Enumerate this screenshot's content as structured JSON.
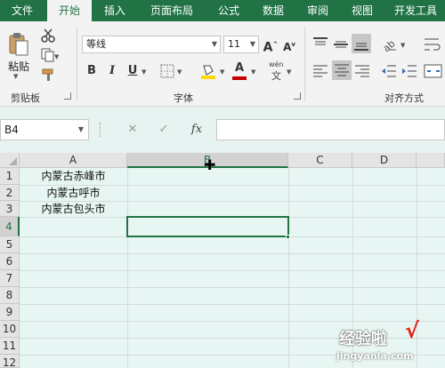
{
  "tabs": [
    "文件",
    "开始",
    "插入",
    "页面布局",
    "公式",
    "数据",
    "审阅",
    "视图",
    "开发工具"
  ],
  "active_tab": "开始",
  "ribbon": {
    "clipboard": {
      "paste_label": "粘贴",
      "group_label": "剪贴板"
    },
    "font": {
      "font_name": "等线",
      "font_size": "11",
      "bold": "B",
      "italic": "I",
      "underline": "U",
      "grow": "A",
      "shrink": "A",
      "font_color": "A",
      "phonetic_top": "wén",
      "phonetic_bottom": "文",
      "group_label": "字体"
    },
    "alignment": {
      "group_label": "对齐方式"
    }
  },
  "formula_bar": {
    "name_box": "B4",
    "cancel": "✕",
    "enter": "✓",
    "fx": "fx",
    "value": ""
  },
  "grid": {
    "columns": [
      "A",
      "B",
      "C",
      "D"
    ],
    "selected_column": "B",
    "rows": [
      "1",
      "2",
      "3",
      "4",
      "5",
      "6",
      "7",
      "8",
      "9",
      "10",
      "11",
      "12"
    ],
    "selected_row": "4",
    "cells": {
      "A1": "内蒙古赤峰市",
      "A2": "内蒙古呼市",
      "A3": "内蒙古包头市"
    },
    "selected_cell": "B4"
  },
  "watermark": {
    "text": "经验啦",
    "url": "jingyanla.com"
  },
  "colors": {
    "accent": "#217346",
    "grid_bg": "#e8f6f3",
    "ribbon_bg": "#f3f3f3"
  }
}
